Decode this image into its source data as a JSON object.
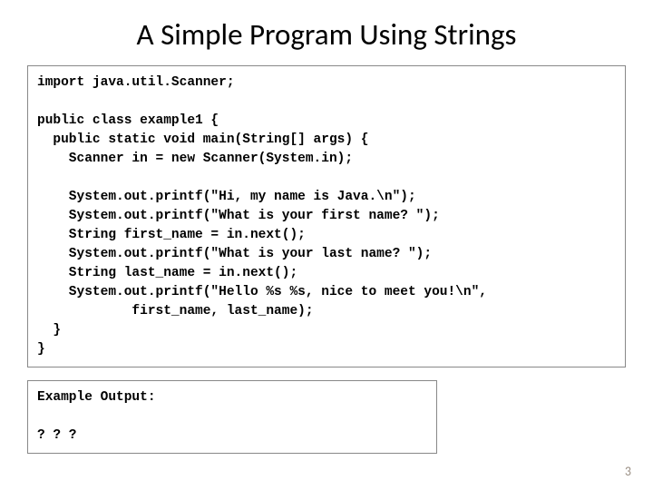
{
  "title": "A Simple Program Using Strings",
  "code": "import java.util.Scanner;\n\npublic class example1 {\n  public static void main(String[] args) {\n    Scanner in = new Scanner(System.in);\n\n    System.out.printf(\"Hi, my name is Java.\\n\");\n    System.out.printf(\"What is your first name? \");\n    String first_name = in.next();\n    System.out.printf(\"What is your last name? \");\n    String last_name = in.next();\n    System.out.printf(\"Hello %s %s, nice to meet you!\\n\",\n            first_name, last_name); \n  }\n}",
  "output_label": "Example Output:",
  "output_value": "? ? ?",
  "page_number": "3"
}
